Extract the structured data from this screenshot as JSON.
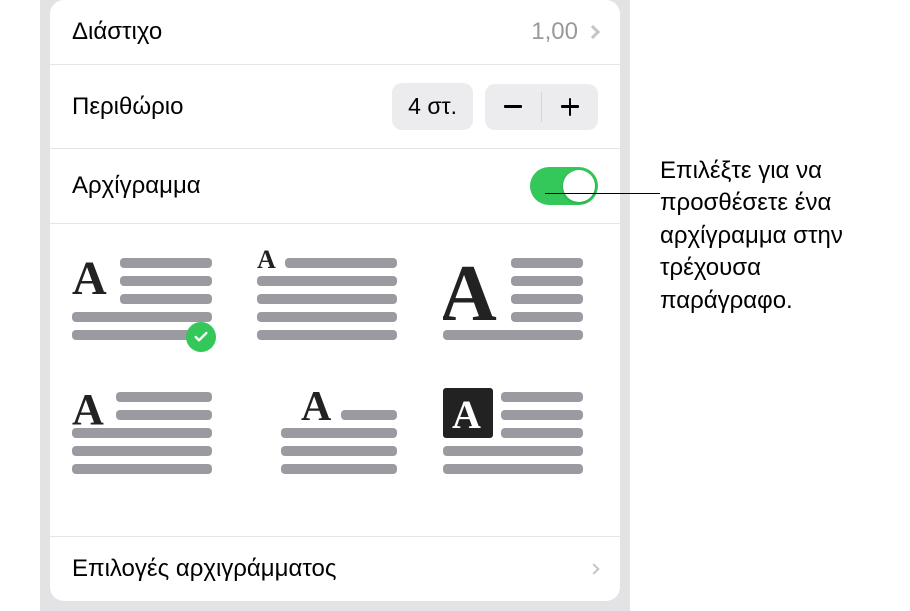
{
  "rows": {
    "spacing": {
      "label": "Διάστιχο",
      "value": "1,00"
    },
    "margin": {
      "label": "Περιθώριο",
      "value": "4 στ."
    },
    "dropcap": {
      "label": "Αρχίγραμμα",
      "on": true
    }
  },
  "options_label": "Επιλογές αρχιγράμματος",
  "dropcap_styles": [
    {
      "key": "style1",
      "selected": true
    },
    {
      "key": "style2",
      "selected": false
    },
    {
      "key": "style3",
      "selected": false
    },
    {
      "key": "style4",
      "selected": false
    },
    {
      "key": "style5",
      "selected": false
    },
    {
      "key": "style6",
      "selected": false
    }
  ],
  "callout": "Επιλέξτε για να προσθέσετε ένα αρχίγραμμα στην τρέχουσα παράγραφο.",
  "colors": {
    "accent": "#34c759",
    "line": "#9a9aa0"
  }
}
